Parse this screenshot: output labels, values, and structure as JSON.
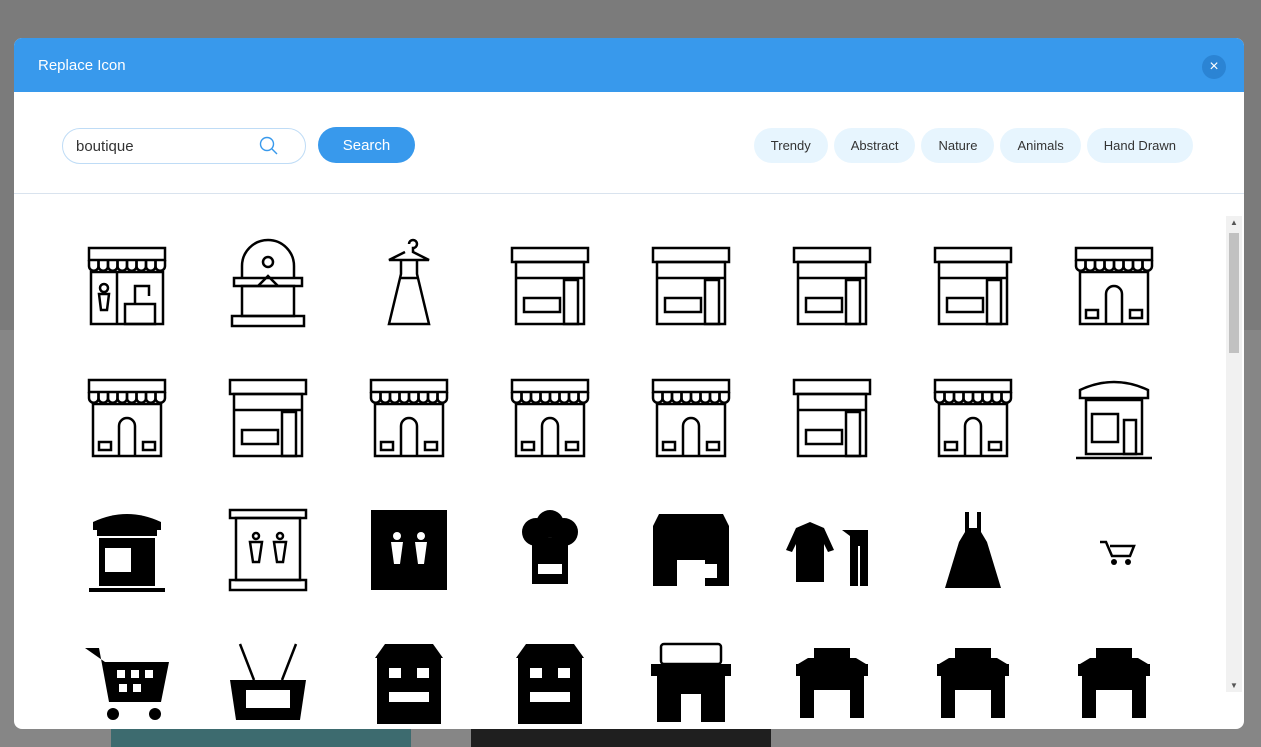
{
  "dialog": {
    "title": "Replace Icon",
    "close_icon": "close-icon"
  },
  "search": {
    "value": "boutique",
    "icon": "search-icon",
    "button_label": "Search"
  },
  "categories": [
    "Trendy",
    "Abstract",
    "Nature",
    "Animals",
    "Hand Drawn"
  ],
  "icons": [
    "boutique-store-outline",
    "kiosk-outline",
    "dress-on-hanger-outline",
    "store-front-outline",
    "store-front-outline",
    "store-front-outline",
    "store-front-outline",
    "store-awning-outline",
    "store-awning-outline",
    "store-front-outline",
    "store-awning-outline",
    "store-awning-outline",
    "store-awning-outline",
    "store-front-outline",
    "store-awning-outline",
    "boutique-lamps-outline",
    "boutique-lamps-solid",
    "mannequin-showcase-outline",
    "mannequin-showcase-solid",
    "chef-hat-solid",
    "store-solid",
    "clothes-hangers-solid",
    "dress-solid",
    "cart-small-solid",
    "shopping-cart-solid",
    "shopping-basket-solid",
    "building-solid",
    "building-solid",
    "store-sign-solid",
    "market-stall-solid",
    "market-stall-solid",
    "market-stall-solid"
  ]
}
